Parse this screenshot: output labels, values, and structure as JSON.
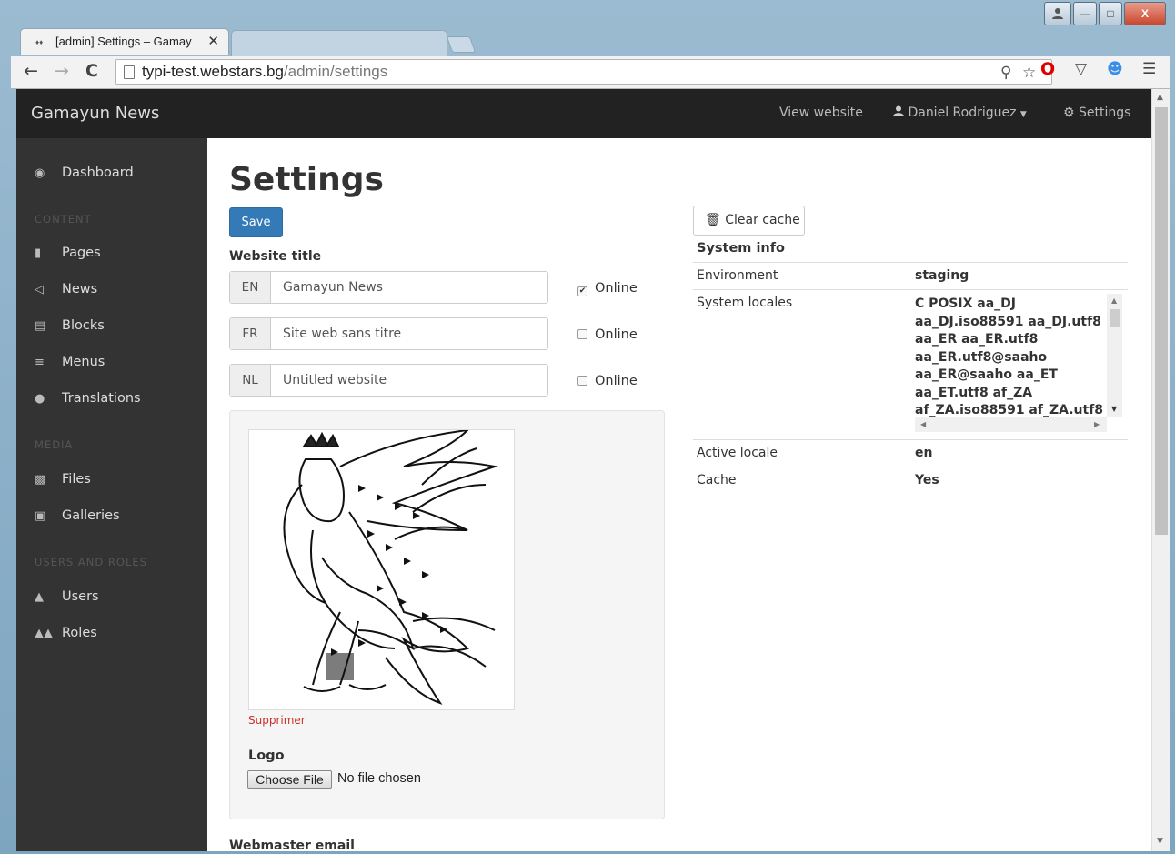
{
  "browser": {
    "active_tab_title": "[admin] Settings – Gamay",
    "favicon_text": "♦♦",
    "tab_close": "✕",
    "url_host": "typi-test.webstars.bg",
    "url_path": "/admin/settings",
    "window_buttons": {
      "minimize": "—",
      "maximize": "□",
      "close": "X"
    }
  },
  "navbar": {
    "brand": "Gamayun News",
    "view_website": "View website",
    "user": "Daniel Rodriguez",
    "settings": "Settings"
  },
  "sidebar": {
    "dashboard": "Dashboard",
    "content_heading": "CONTENT",
    "content_items": [
      "Pages",
      "News",
      "Blocks",
      "Menus",
      "Translations"
    ],
    "media_heading": "MEDIA",
    "media_items": [
      "Files",
      "Galleries"
    ],
    "users_heading": "USERS AND ROLES",
    "users_items": [
      "Users",
      "Roles"
    ]
  },
  "page": {
    "title": "Settings",
    "save_label": "Save",
    "website_title_label": "Website title",
    "titles": [
      {
        "lang": "EN",
        "value": "Gamayun News",
        "online_label": "Online",
        "online": true
      },
      {
        "lang": "FR",
        "value": "Site web sans titre",
        "online_label": "Online",
        "online": false
      },
      {
        "lang": "NL",
        "value": "Untitled website",
        "online_label": "Online",
        "online": false
      }
    ],
    "delete_label": "Supprimer",
    "logo_label": "Logo",
    "choose_file_label": "Choose File",
    "no_file_text": "No file chosen",
    "webmaster_email_label": "Webmaster email"
  },
  "system": {
    "clear_cache_label": "Clear cache",
    "title": "System info",
    "environment_key": "Environment",
    "environment_value": "staging",
    "locales_key": "System locales",
    "locales_value": "C POSIX aa_DJ\naa_DJ.iso88591 aa_DJ.utf8\naa_ER aa_ER.utf8\naa_ER.utf8@saaho\naa_ER@saaho aa_ET\naa_ET.utf8 af_ZA\naf_ZA.iso88591 af_ZA.utf8",
    "active_locale_key": "Active locale",
    "active_locale_value": "en",
    "cache_key": "Cache",
    "cache_value": "Yes"
  },
  "colors": {
    "primary": "#337ab7",
    "navbar_bg": "#222222",
    "sidebar_bg": "#333333",
    "danger": "#c9302c"
  }
}
